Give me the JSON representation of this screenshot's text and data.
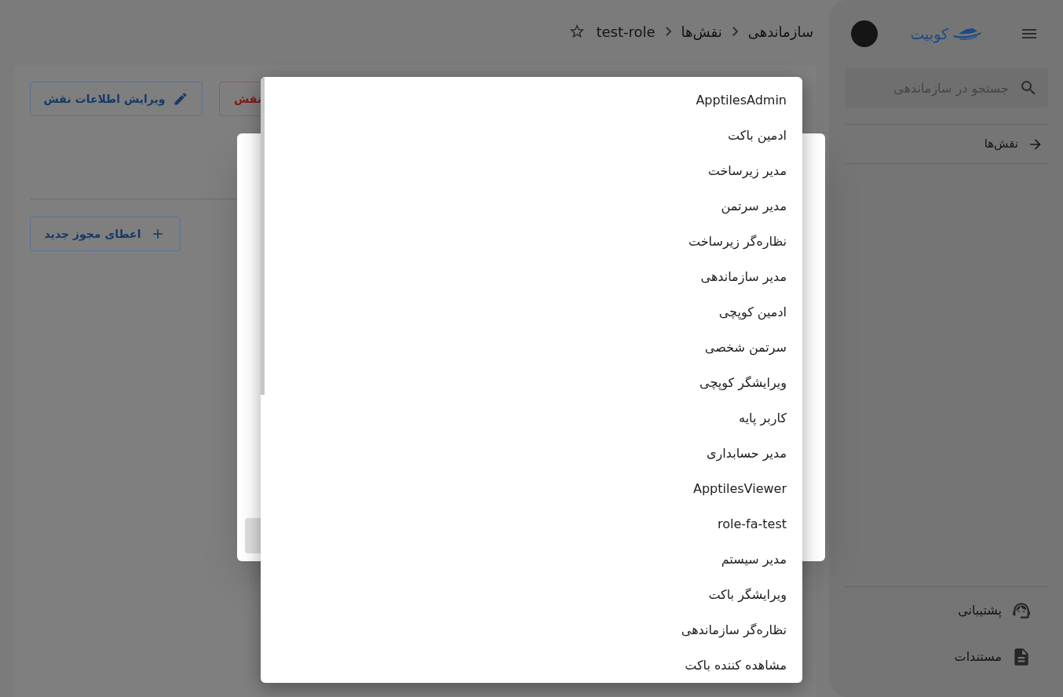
{
  "sidebar": {
    "logo": "کوبیت",
    "search": {
      "placeholder": "جستجو در سازماندهی"
    },
    "nav_items": [
      {
        "label": "نقش‌ها"
      }
    ],
    "footer_items": [
      {
        "label": "پشتیبانی",
        "kind": "support"
      },
      {
        "label": "مستندات",
        "kind": "docs"
      }
    ]
  },
  "breadcrumbs": [
    "سازماندهی",
    "نقش‌ها",
    "test-role"
  ],
  "actions": [
    {
      "label": "نقش",
      "kind": "danger"
    },
    {
      "label": "ویرایش اطلاعات نقش",
      "kind": "edit"
    }
  ],
  "grant_button": {
    "label": "اعطای مجوز جدید"
  },
  "dropdown": {
    "options": [
      "ApptilesAdmin",
      "ادمین باکت",
      "مدیر زیرساخت",
      "مدیر سرتمن",
      "نظاره‌گر زیرساخت",
      "مدیر سازماندهی",
      "ادمین کوپچی",
      "سرتمن شخصی",
      "ویرایشگر کوپچی",
      "کاربر پایه",
      "مدیر حسابداری",
      "ApptilesViewer",
      "role-fa-test",
      "مدیر سیستم",
      "ویرایشگر باکت",
      "نظاره‌گر سازماندهی",
      "مشاهده کننده باکت"
    ]
  }
}
